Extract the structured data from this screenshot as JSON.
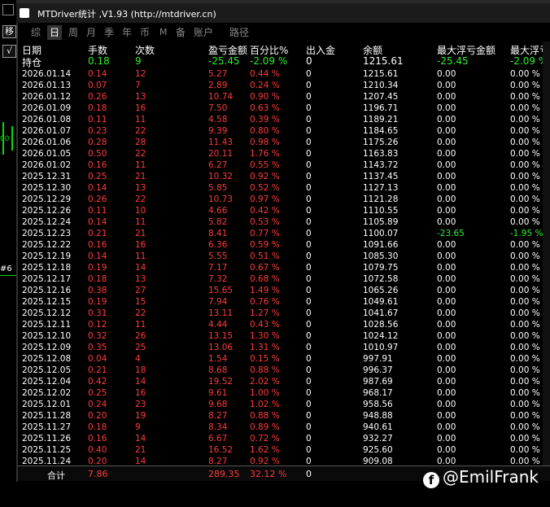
{
  "title": "MTDriver统计 ,V1.93 (http://mtdriver.cn)",
  "left_panel": {
    "btn1": "移",
    "btn2": "√",
    "mark_label": "#6"
  },
  "tabs": [
    {
      "label": "综"
    },
    {
      "label": "日"
    },
    {
      "label": "周"
    },
    {
      "label": "月"
    },
    {
      "label": "季"
    },
    {
      "label": "年"
    },
    {
      "label": "币"
    },
    {
      "label": "M"
    },
    {
      "label": "备"
    },
    {
      "label": "账户"
    },
    {
      "label": "路径"
    }
  ],
  "active_tab": "日",
  "headers": {
    "date": "日期",
    "lots": "手数",
    "count": "次数",
    "pnl": "盈亏金额",
    "pct": "百分比%",
    "deposit": "出入金",
    "balance": "余额",
    "max_float_loss": "最大浮亏金额",
    "max_float_loss_pct": "最大浮亏"
  },
  "position": {
    "date": "持仓",
    "lots": "0.18",
    "count": "9",
    "pnl": "-25.45",
    "pct": "-2.09 %",
    "deposit": "0",
    "balance": "1215.61",
    "mfe": "-25.45",
    "mfp": "-2.09 %"
  },
  "rows": [
    {
      "date": "2026.01.14",
      "lots": "0.14",
      "count": "12",
      "pnl": "5.27",
      "pct": "0.44 %",
      "deposit": "0",
      "balance": "1215.61",
      "mfe": "0.00",
      "mfp": "0.00 %"
    },
    {
      "date": "2026.01.13",
      "lots": "0.07",
      "count": "7",
      "pnl": "2.89",
      "pct": "0.24 %",
      "deposit": "0",
      "balance": "1210.34",
      "mfe": "0.00",
      "mfp": "0.00 %"
    },
    {
      "date": "2026.01.12",
      "lots": "0.26",
      "count": "13",
      "pnl": "10.74",
      "pct": "0.90 %",
      "deposit": "0",
      "balance": "1207.45",
      "mfe": "0.00",
      "mfp": "0.00 %"
    },
    {
      "date": "2026.01.09",
      "lots": "0.18",
      "count": "16",
      "pnl": "7.50",
      "pct": "0.63 %",
      "deposit": "0",
      "balance": "1196.71",
      "mfe": "0.00",
      "mfp": "0.00 %"
    },
    {
      "date": "2026.01.08",
      "lots": "0.11",
      "count": "11",
      "pnl": "4.58",
      "pct": "0.39 %",
      "deposit": "0",
      "balance": "1189.21",
      "mfe": "0.00",
      "mfp": "0.00 %"
    },
    {
      "date": "2026.01.07",
      "lots": "0.23",
      "count": "22",
      "pnl": "9.39",
      "pct": "0.80 %",
      "deposit": "0",
      "balance": "1184.65",
      "mfe": "0.00",
      "mfp": "0.00 %"
    },
    {
      "date": "2026.01.06",
      "lots": "0.28",
      "count": "28",
      "pnl": "11.43",
      "pct": "0.98 %",
      "deposit": "0",
      "balance": "1175.26",
      "mfe": "0.00",
      "mfp": "0.00 %"
    },
    {
      "date": "2026.01.05",
      "lots": "0.50",
      "count": "22",
      "pnl": "20.11",
      "pct": "1.76 %",
      "deposit": "0",
      "balance": "1163.83",
      "mfe": "0.00",
      "mfp": "0.00 %"
    },
    {
      "date": "2026.01.02",
      "lots": "0.16",
      "count": "11",
      "pnl": "6.27",
      "pct": "0.55 %",
      "deposit": "0",
      "balance": "1143.72",
      "mfe": "0.00",
      "mfp": "0.00 %"
    },
    {
      "date": "2025.12.31",
      "lots": "0.25",
      "count": "21",
      "pnl": "10.32",
      "pct": "0.92 %",
      "deposit": "0",
      "balance": "1137.45",
      "mfe": "0.00",
      "mfp": "0.00 %"
    },
    {
      "date": "2025.12.30",
      "lots": "0.14",
      "count": "13",
      "pnl": "5.85",
      "pct": "0.52 %",
      "deposit": "0",
      "balance": "1127.13",
      "mfe": "0.00",
      "mfp": "0.00 %"
    },
    {
      "date": "2025.12.29",
      "lots": "0.26",
      "count": "22",
      "pnl": "10.73",
      "pct": "0.97 %",
      "deposit": "0",
      "balance": "1121.28",
      "mfe": "0.00",
      "mfp": "0.00 %"
    },
    {
      "date": "2025.12.26",
      "lots": "0.11",
      "count": "10",
      "pnl": "4.66",
      "pct": "0.42 %",
      "deposit": "0",
      "balance": "1110.55",
      "mfe": "0.00",
      "mfp": "0.00 %"
    },
    {
      "date": "2025.12.24",
      "lots": "0.14",
      "count": "11",
      "pnl": "5.82",
      "pct": "0.53 %",
      "deposit": "0",
      "balance": "1105.89",
      "mfe": "0.00",
      "mfp": "0.00 %"
    },
    {
      "date": "2025.12.23",
      "lots": "0.21",
      "count": "21",
      "pnl": "8.41",
      "pct": "0.77 %",
      "deposit": "0",
      "balance": "1100.07",
      "mfe": "-23.65",
      "mfp": "-1.95 %"
    },
    {
      "date": "2025.12.22",
      "lots": "0.16",
      "count": "16",
      "pnl": "6.36",
      "pct": "0.59 %",
      "deposit": "0",
      "balance": "1091.66",
      "mfe": "0.00",
      "mfp": "0.00 %"
    },
    {
      "date": "2025.12.19",
      "lots": "0.14",
      "count": "11",
      "pnl": "5.55",
      "pct": "0.51 %",
      "deposit": "0",
      "balance": "1085.30",
      "mfe": "0.00",
      "mfp": "0.00 %"
    },
    {
      "date": "2025.12.18",
      "lots": "0.19",
      "count": "14",
      "pnl": "7.17",
      "pct": "0.67 %",
      "deposit": "0",
      "balance": "1079.75",
      "mfe": "0.00",
      "mfp": "0.00 %"
    },
    {
      "date": "2025.12.17",
      "lots": "0.18",
      "count": "13",
      "pnl": "7.32",
      "pct": "0.68 %",
      "deposit": "0",
      "balance": "1072.58",
      "mfe": "0.00",
      "mfp": "0.00 %"
    },
    {
      "date": "2025.12.16",
      "lots": "0.38",
      "count": "27",
      "pnl": "15.65",
      "pct": "1.49 %",
      "deposit": "0",
      "balance": "1065.26",
      "mfe": "0.00",
      "mfp": "0.00 %"
    },
    {
      "date": "2025.12.15",
      "lots": "0.19",
      "count": "15",
      "pnl": "7.94",
      "pct": "0.76 %",
      "deposit": "0",
      "balance": "1049.61",
      "mfe": "0.00",
      "mfp": "0.00 %"
    },
    {
      "date": "2025.12.12",
      "lots": "0.31",
      "count": "22",
      "pnl": "13.11",
      "pct": "1.27 %",
      "deposit": "0",
      "balance": "1041.67",
      "mfe": "0.00",
      "mfp": "0.00 %"
    },
    {
      "date": "2025.12.11",
      "lots": "0.12",
      "count": "11",
      "pnl": "4.44",
      "pct": "0.43 %",
      "deposit": "0",
      "balance": "1028.56",
      "mfe": "0.00",
      "mfp": "0.00 %"
    },
    {
      "date": "2025.12.10",
      "lots": "0.32",
      "count": "26",
      "pnl": "13.15",
      "pct": "1.30 %",
      "deposit": "0",
      "balance": "1024.12",
      "mfe": "0.00",
      "mfp": "0.00 %"
    },
    {
      "date": "2025.12.09",
      "lots": "0.35",
      "count": "25",
      "pnl": "13.06",
      "pct": "1.31 %",
      "deposit": "0",
      "balance": "1010.97",
      "mfe": "0.00",
      "mfp": "0.00 %"
    },
    {
      "date": "2025.12.08",
      "lots": "0.04",
      "count": "4",
      "pnl": "1.54",
      "pct": "0.15 %",
      "deposit": "0",
      "balance": "997.91",
      "mfe": "0.00",
      "mfp": "0.00 %"
    },
    {
      "date": "2025.12.05",
      "lots": "0.21",
      "count": "18",
      "pnl": "8.68",
      "pct": "0.88 %",
      "deposit": "0",
      "balance": "996.37",
      "mfe": "0.00",
      "mfp": "0.00 %"
    },
    {
      "date": "2025.12.04",
      "lots": "0.42",
      "count": "14",
      "pnl": "19.52",
      "pct": "2.02 %",
      "deposit": "0",
      "balance": "987.69",
      "mfe": "0.00",
      "mfp": "0.00 %"
    },
    {
      "date": "2025.12.02",
      "lots": "0.25",
      "count": "16",
      "pnl": "9.61",
      "pct": "1.00 %",
      "deposit": "0",
      "balance": "968.17",
      "mfe": "0.00",
      "mfp": "0.00 %"
    },
    {
      "date": "2025.12.01",
      "lots": "0.24",
      "count": "23",
      "pnl": "9.68",
      "pct": "1.02 %",
      "deposit": "0",
      "balance": "958.56",
      "mfe": "0.00",
      "mfp": "0.00 %"
    },
    {
      "date": "2025.11.28",
      "lots": "0.20",
      "count": "19",
      "pnl": "8.27",
      "pct": "0.88 %",
      "deposit": "0",
      "balance": "948.88",
      "mfe": "0.00",
      "mfp": "0.00 %"
    },
    {
      "date": "2025.11.27",
      "lots": "0.18",
      "count": "9",
      "pnl": "8.34",
      "pct": "0.89 %",
      "deposit": "0",
      "balance": "940.61",
      "mfe": "0.00",
      "mfp": "0.00 %"
    },
    {
      "date": "2025.11.26",
      "lots": "0.16",
      "count": "14",
      "pnl": "6.67",
      "pct": "0.72 %",
      "deposit": "0",
      "balance": "932.27",
      "mfe": "0.00",
      "mfp": "0.00 %"
    },
    {
      "date": "2025.11.25",
      "lots": "0.40",
      "count": "21",
      "pnl": "16.52",
      "pct": "1.62 %",
      "deposit": "0",
      "balance": "925.60",
      "mfe": "0.00",
      "mfp": "0.00 %"
    },
    {
      "date": "2025.11.24",
      "lots": "0.20",
      "count": "14",
      "pnl": "8.27",
      "pct": "0.92 %",
      "deposit": "0",
      "balance": "909.08",
      "mfe": "0.00",
      "mfp": "0.00 %"
    }
  ],
  "footer": {
    "label": "合计",
    "lots": "7.86",
    "pnl": "289.35",
    "pct": "32.12 %",
    "deposit": "0"
  },
  "watermark": "@EmilFrank",
  "colors": {
    "loss": "#ff3b3b",
    "profit_highlight": "#2ef02e",
    "text": "#ffffff",
    "background": "#000000"
  }
}
